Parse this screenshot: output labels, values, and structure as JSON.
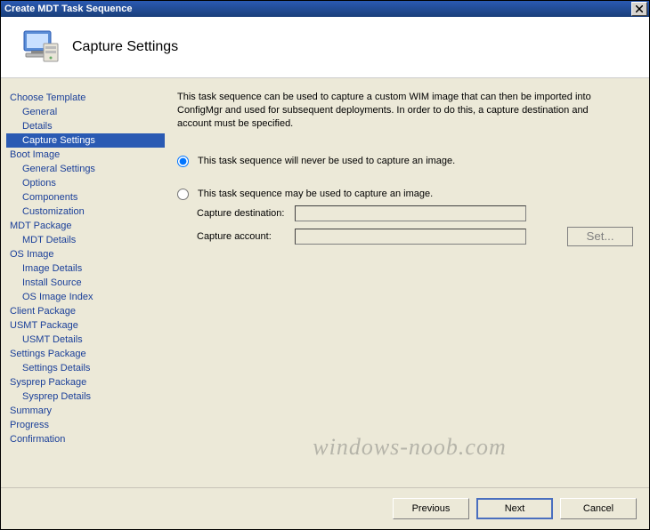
{
  "window": {
    "title": "Create MDT Task Sequence"
  },
  "header": {
    "title": "Capture Settings"
  },
  "sidebar": {
    "items": [
      {
        "label": "Choose Template",
        "sub": false
      },
      {
        "label": "General",
        "sub": true
      },
      {
        "label": "Details",
        "sub": true
      },
      {
        "label": "Capture Settings",
        "sub": true,
        "selected": true
      },
      {
        "label": "Boot Image",
        "sub": false
      },
      {
        "label": "General Settings",
        "sub": true
      },
      {
        "label": "Options",
        "sub": true
      },
      {
        "label": "Components",
        "sub": true
      },
      {
        "label": "Customization",
        "sub": true
      },
      {
        "label": "MDT Package",
        "sub": false
      },
      {
        "label": "MDT Details",
        "sub": true
      },
      {
        "label": "OS Image",
        "sub": false
      },
      {
        "label": "Image Details",
        "sub": true
      },
      {
        "label": "Install Source",
        "sub": true
      },
      {
        "label": "OS Image Index",
        "sub": true
      },
      {
        "label": "Client Package",
        "sub": false
      },
      {
        "label": "USMT Package",
        "sub": false
      },
      {
        "label": "USMT Details",
        "sub": true
      },
      {
        "label": "Settings Package",
        "sub": false
      },
      {
        "label": "Settings Details",
        "sub": true
      },
      {
        "label": "Sysprep Package",
        "sub": false
      },
      {
        "label": "Sysprep Details",
        "sub": true
      },
      {
        "label": "Summary",
        "sub": false
      },
      {
        "label": "Progress",
        "sub": false
      },
      {
        "label": "Confirmation",
        "sub": false
      }
    ]
  },
  "main": {
    "description": "This task sequence can be used to capture a custom WIM image that can then be imported into ConfigMgr and used for subsequent deployments.  In order to do this, a capture destination and account must be specified.",
    "radio1": "This task sequence will never be used to capture an image.",
    "radio2": "This task sequence may be used to capture an image.",
    "capture_dest_label": "Capture destination:",
    "capture_dest_value": "",
    "capture_acct_label": "Capture account:",
    "capture_acct_value": "",
    "set_button": "Set..."
  },
  "footer": {
    "previous": "Previous",
    "next": "Next",
    "cancel": "Cancel"
  },
  "watermark": "windows-noob.com"
}
